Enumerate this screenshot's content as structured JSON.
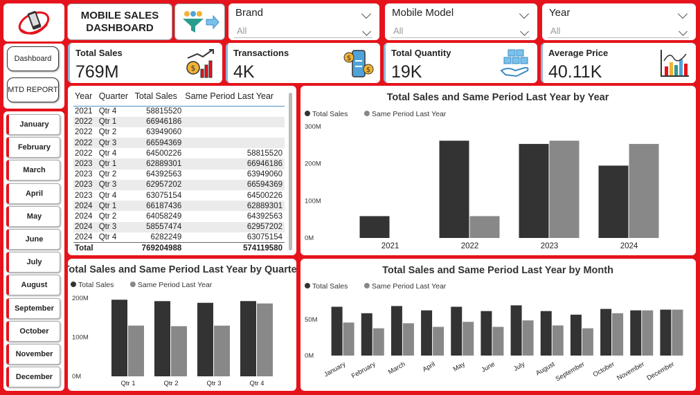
{
  "header": {
    "title": "MOBILE SALES\nDASHBOARD"
  },
  "slicers": [
    {
      "label": "Brand",
      "value": "All"
    },
    {
      "label": "Mobile Model",
      "value": "All"
    },
    {
      "label": "Year",
      "value": "All"
    }
  ],
  "nav": {
    "dashboard": "Dashboard",
    "mtd_report": "MTD REPORT",
    "months": [
      "January",
      "February",
      "March",
      "April",
      "May",
      "June",
      "July",
      "August",
      "September",
      "October",
      "November",
      "December"
    ]
  },
  "kpis": [
    {
      "label": "Total Sales",
      "value": "769M",
      "icon": "sales-growth-icon"
    },
    {
      "label": "Transactions",
      "value": "4K",
      "icon": "phone-transaction-icon"
    },
    {
      "label": "Total Quantity",
      "value": "19K",
      "icon": "boxes-hand-icon"
    },
    {
      "label": "Average Price",
      "value": "40.11K",
      "icon": "price-chart-icon"
    }
  ],
  "table": {
    "columns": [
      "Year",
      "Quarter",
      "Total Sales",
      "Same Period Last Year"
    ],
    "rows": [
      [
        "2021",
        "Qtr 4",
        "58815520",
        ""
      ],
      [
        "2022",
        "Qtr 1",
        "66946186",
        ""
      ],
      [
        "2022",
        "Qtr 2",
        "63949060",
        ""
      ],
      [
        "2022",
        "Qtr 3",
        "66594369",
        ""
      ],
      [
        "2022",
        "Qtr 4",
        "64500226",
        "58815520"
      ],
      [
        "2023",
        "Qtr 1",
        "62889301",
        "66946186"
      ],
      [
        "2023",
        "Qtr 2",
        "64392563",
        "63949060"
      ],
      [
        "2023",
        "Qtr 3",
        "62957202",
        "66594369"
      ],
      [
        "2023",
        "Qtr 4",
        "63075154",
        "64500226"
      ],
      [
        "2024",
        "Qtr 1",
        "66187436",
        "62889301"
      ],
      [
        "2024",
        "Qtr 2",
        "64058249",
        "64392563"
      ],
      [
        "2024",
        "Qtr 3",
        "58557474",
        "62957202"
      ],
      [
        "2024",
        "Qtr 4",
        "6282249",
        "63075154"
      ]
    ],
    "total": [
      "Total",
      "",
      "769204988",
      "574119580"
    ]
  },
  "colors": {
    "primary": "#333333",
    "secondary": "#888888",
    "accent": "#e5131b"
  },
  "chart_data": [
    {
      "id": "by-year",
      "type": "bar",
      "title": "Total Sales and Same Period Last Year by Year",
      "categories": [
        "2021",
        "2022",
        "2023",
        "2024"
      ],
      "series": [
        {
          "name": "Total Sales",
          "values": [
            58.8,
            262.0,
            253.3,
            194.9
          ]
        },
        {
          "name": "Same Period Last Year",
          "values": [
            0,
            58.8,
            262.0,
            253.3
          ]
        }
      ],
      "yticks": [
        "0M",
        "100M",
        "200M",
        "300M"
      ],
      "ylim": [
        0,
        300
      ],
      "legend": "top-left"
    },
    {
      "id": "by-quarter",
      "type": "bar",
      "title": "Total Sales and Same Period Last Year by Quarter",
      "categories": [
        "Qtr 1",
        "Qtr 2",
        "Qtr 3",
        "Qtr 4"
      ],
      "series": [
        {
          "name": "Total Sales",
          "values": [
            196.0,
            192.4,
            188.1,
            192.5
          ]
        },
        {
          "name": "Same Period Last Year",
          "values": [
            129.8,
            128.3,
            129.6,
            186.4
          ]
        }
      ],
      "yticks": [
        "0M",
        "100M",
        "200M"
      ],
      "ylim": [
        0,
        200
      ],
      "legend": "top-left"
    },
    {
      "id": "by-month",
      "type": "bar",
      "title": "Total Sales and Same Period Last Year by Month",
      "categories": [
        "January",
        "February",
        "March",
        "April",
        "May",
        "June",
        "July",
        "August",
        "September",
        "October",
        "November",
        "December"
      ],
      "series": [
        {
          "name": "Total Sales",
          "values": [
            68,
            59,
            69,
            63,
            68,
            62,
            70,
            62,
            57,
            65,
            63,
            64
          ]
        },
        {
          "name": "Same Period Last Year",
          "values": [
            46,
            38,
            45,
            40,
            47,
            40,
            49,
            42,
            38,
            59,
            63,
            64
          ]
        }
      ],
      "yticks": [
        "0M",
        "50M"
      ],
      "ylim": [
        0,
        80
      ],
      "legend": "top-left"
    }
  ]
}
